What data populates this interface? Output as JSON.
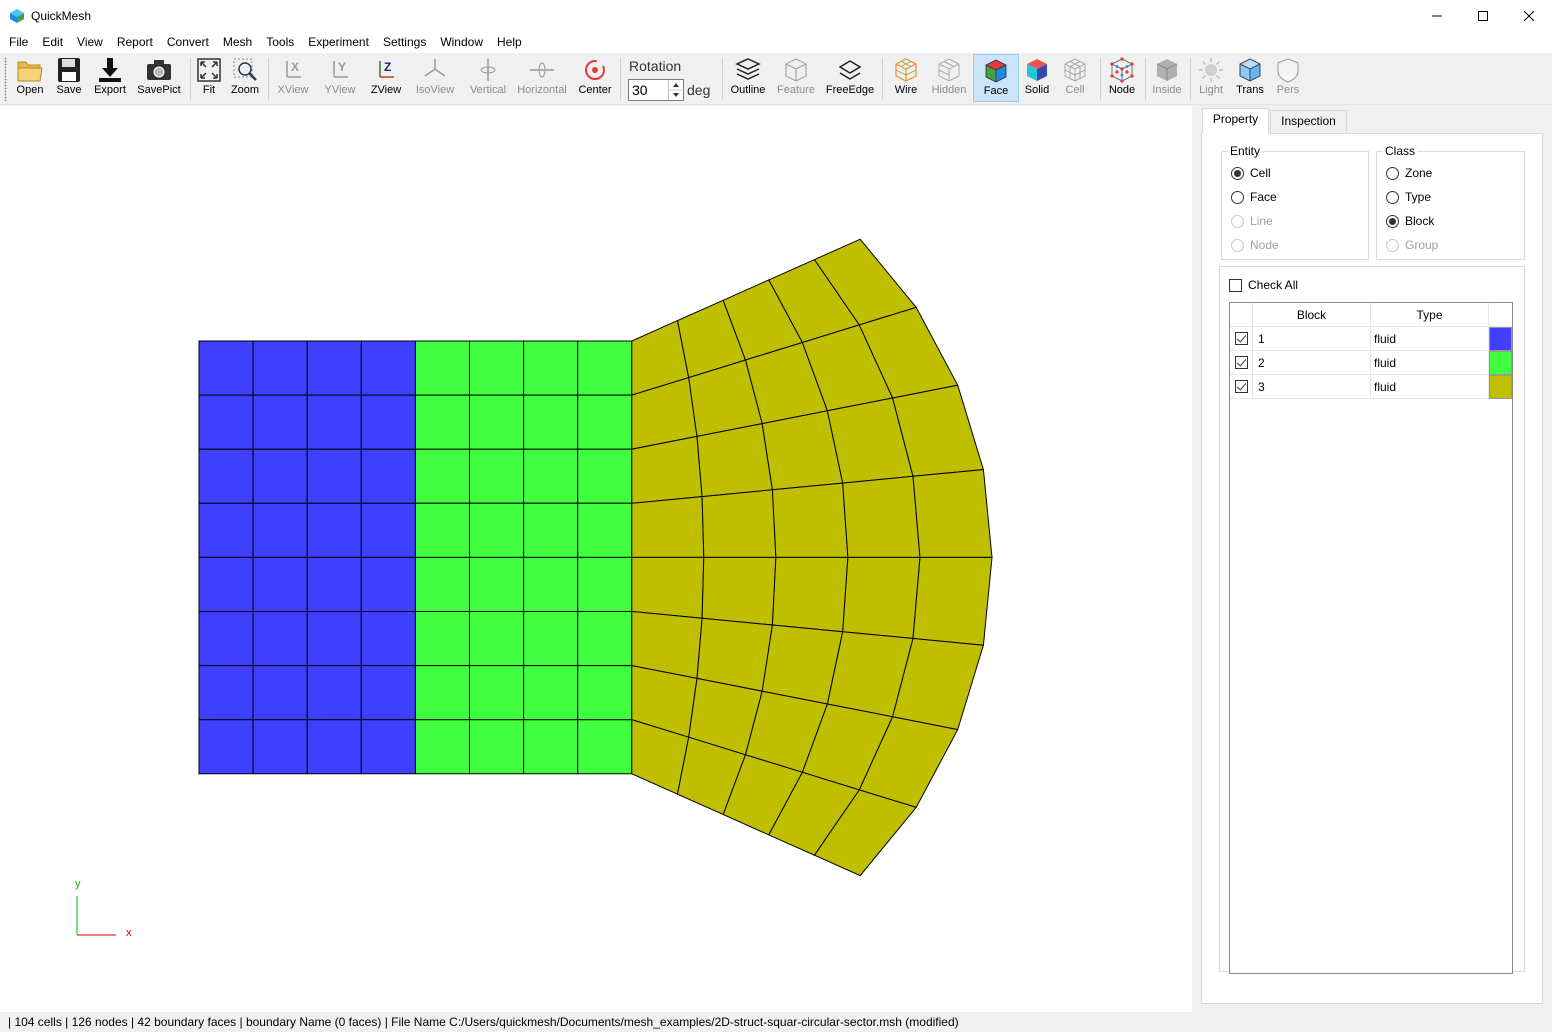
{
  "window": {
    "title": "QuickMesh"
  },
  "menu": [
    "File",
    "Edit",
    "View",
    "Report",
    "Convert",
    "Mesh",
    "Tools",
    "Experiment",
    "Settings",
    "Window",
    "Help"
  ],
  "toolbar": {
    "open": "Open",
    "save": "Save",
    "export": "Export",
    "savepict": "SavePict",
    "fit": "Fit",
    "zoom": "Zoom",
    "xview": "XView",
    "yview": "YView",
    "zview": "ZView",
    "isoview": "IsoView",
    "vertical": "Vertical",
    "horizontal": "Horizontal",
    "center": "Center",
    "rotation_label": "Rotation",
    "rotation_value": "30",
    "rotation_unit": "deg",
    "outline": "Outline",
    "feature": "Feature",
    "freeedge": "FreeEdge",
    "wire": "Wire",
    "hidden": "Hidden",
    "face": "Face",
    "solid": "Solid",
    "cell": "Cell",
    "node": "Node",
    "inside": "Inside",
    "light": "Light",
    "trans": "Trans",
    "pers": "Pers"
  },
  "viewport": {
    "axis_y": "y",
    "axis_x": "x",
    "colors": {
      "block1": "#3f3fff",
      "block2": "#3fff3f",
      "block3": "#bfbf00",
      "edge": "#000000"
    }
  },
  "panel": {
    "tabs": [
      "Property",
      "Inspection"
    ],
    "entity": {
      "title": "Entity",
      "options": [
        "Cell",
        "Face",
        "Line",
        "Node"
      ],
      "selected": "Cell"
    },
    "class": {
      "title": "Class",
      "options": [
        "Zone",
        "Type",
        "Block",
        "Group"
      ],
      "selected": "Block"
    },
    "check_all": "Check All",
    "table": {
      "headers": [
        "Block",
        "Type"
      ],
      "rows": [
        {
          "block": "1",
          "type": "fluid",
          "color": "#3f3fff",
          "checked": true
        },
        {
          "block": "2",
          "type": "fluid",
          "color": "#3fff3f",
          "checked": true
        },
        {
          "block": "3",
          "type": "fluid",
          "color": "#bfbf00",
          "checked": true
        }
      ]
    }
  },
  "status": {
    "text": "| 104 cells | 126 nodes | 42 boundary faces |  boundary Name  (0 faces) | File Name C:/Users/quickmesh/Documents/mesh_examples/2D-struct-squar-circular-sector.msh (modified)"
  }
}
